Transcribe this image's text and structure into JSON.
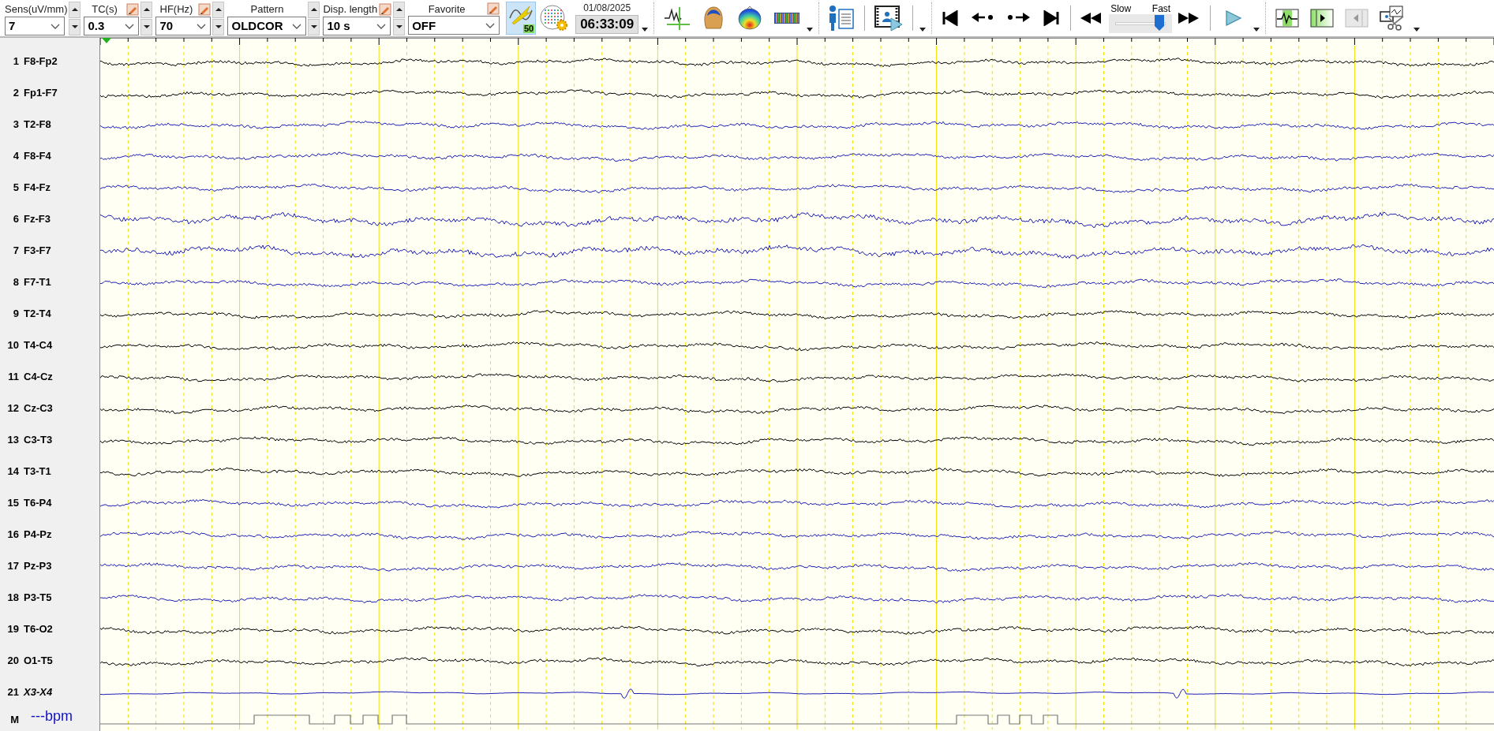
{
  "toolbar": {
    "controls": [
      {
        "label": "Sens(uV/mm)",
        "value": "7",
        "editable": false,
        "spinner": true
      },
      {
        "label": "TC(s)",
        "value": "0.3",
        "editable": true,
        "spinner": true
      },
      {
        "label": "HF(Hz)",
        "value": "70",
        "editable": true,
        "spinner": true
      },
      {
        "label": "Pattern",
        "value": "OLDCOR",
        "editable": false,
        "spinner": true
      },
      {
        "label": "Disp. length",
        "value": "10 s",
        "editable": true,
        "spinner": true
      },
      {
        "label": "Favorite",
        "value": "OFF",
        "editable": true,
        "spinner": false
      }
    ],
    "notch_filter": {
      "label": "50",
      "selected": true
    },
    "date": "01/08/2025",
    "time": "06:33:09",
    "speed": {
      "slow_label": "Slow",
      "fast_label": "Fast",
      "level": 0.85
    }
  },
  "channels": [
    {
      "number": "1",
      "name": "F8-Fp2",
      "color": "#000000",
      "kind": "eeg"
    },
    {
      "number": "2",
      "name": "Fp1-F7",
      "color": "#000000",
      "kind": "eeg"
    },
    {
      "number": "3",
      "name": "T2-F8",
      "color": "#1f1fb4",
      "kind": "eeg"
    },
    {
      "number": "4",
      "name": "F8-F4",
      "color": "#1f1fb4",
      "kind": "eeg"
    },
    {
      "number": "5",
      "name": "F4-Fz",
      "color": "#1f1fb4",
      "kind": "eeg"
    },
    {
      "number": "6",
      "name": "Fz-F3",
      "color": "#1f1fb4",
      "kind": "eeg"
    },
    {
      "number": "7",
      "name": "F3-F7",
      "color": "#1f1fb4",
      "kind": "eeg"
    },
    {
      "number": "8",
      "name": "F7-T1",
      "color": "#1f1fb4",
      "kind": "eeg"
    },
    {
      "number": "9",
      "name": "T2-T4",
      "color": "#000000",
      "kind": "eeg"
    },
    {
      "number": "10",
      "name": "T4-C4",
      "color": "#000000",
      "kind": "eeg"
    },
    {
      "number": "11",
      "name": "C4-Cz",
      "color": "#000000",
      "kind": "eeg"
    },
    {
      "number": "12",
      "name": "Cz-C3",
      "color": "#000000",
      "kind": "eeg"
    },
    {
      "number": "13",
      "name": "C3-T3",
      "color": "#000000",
      "kind": "eeg"
    },
    {
      "number": "14",
      "name": "T3-T1",
      "color": "#000000",
      "kind": "eeg"
    },
    {
      "number": "15",
      "name": "T6-P4",
      "color": "#1f1fb4",
      "kind": "eeg"
    },
    {
      "number": "16",
      "name": "P4-Pz",
      "color": "#1f1fb4",
      "kind": "eeg"
    },
    {
      "number": "17",
      "name": "Pz-P3",
      "color": "#1f1fb4",
      "kind": "eeg"
    },
    {
      "number": "18",
      "name": "P3-T5",
      "color": "#1f1fb4",
      "kind": "eeg"
    },
    {
      "number": "19",
      "name": "T6-O2",
      "color": "#000000",
      "kind": "eeg"
    },
    {
      "number": "20",
      "name": "O1-T5",
      "color": "#000000",
      "kind": "eeg"
    },
    {
      "number": "21",
      "name": "X3-X4",
      "color": "#1f1fb4",
      "kind": "aux"
    }
  ],
  "marker_row": {
    "label": "M",
    "heart_rate": "---bpm"
  }
}
